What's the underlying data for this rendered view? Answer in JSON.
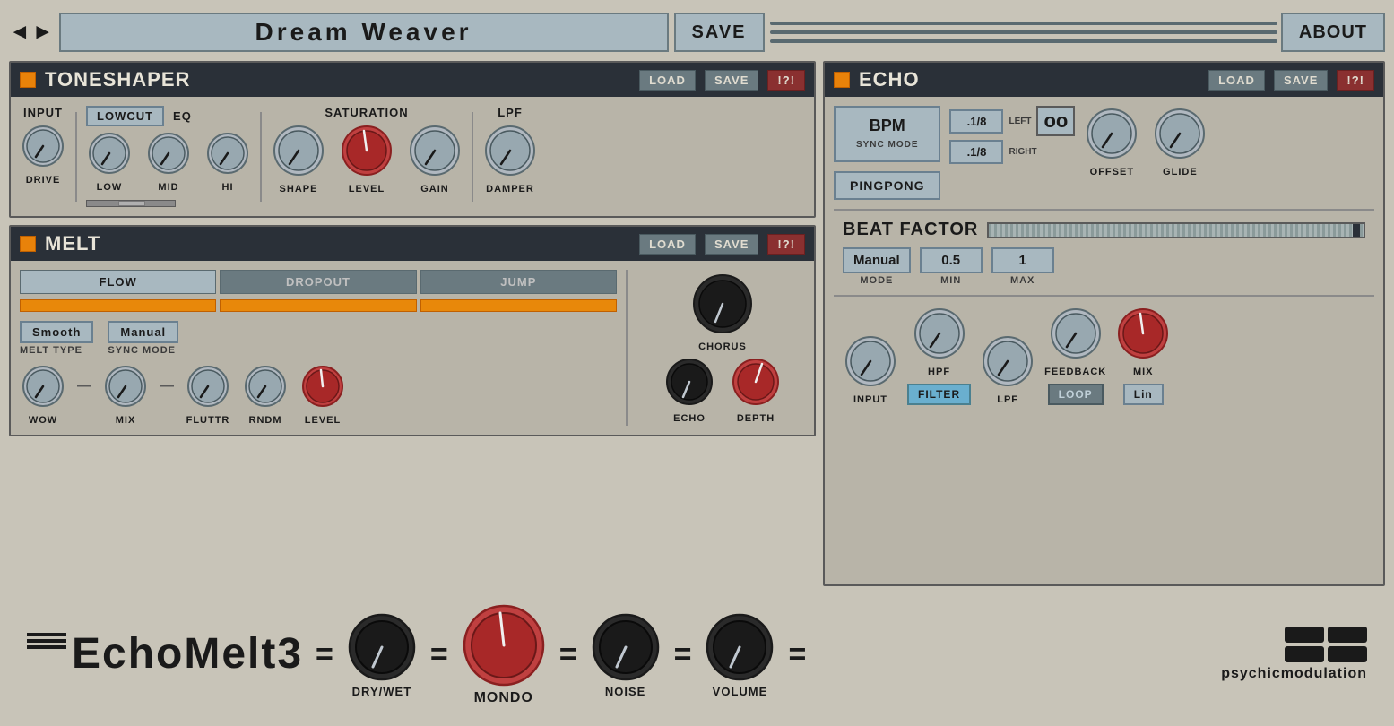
{
  "header": {
    "preset_name": "Dream  Weaver",
    "save_label": "SAVE",
    "about_label": "ABOUT",
    "arrow_left": "◄",
    "arrow_right": "►"
  },
  "toneshaper": {
    "title": "TONESHAPER",
    "load_label": "LOAD",
    "save_label": "SAVE",
    "danger_label": "!?!",
    "input_label": "INPUT",
    "drive_label": "DRIVE",
    "lowcut_label": "LOWCUT",
    "eq_label": "EQ",
    "low_label": "LOW",
    "mid_label": "MID",
    "hi_label": "HI",
    "saturation_label": "SATURATION",
    "shape_label": "SHAPE",
    "level_label": "LEVEL",
    "gain_label": "GAIN",
    "lpf_label": "LPF",
    "damper_label": "DAMPER"
  },
  "melt": {
    "title": "MELT",
    "load_label": "LOAD",
    "save_label": "SAVE",
    "danger_label": "!?!",
    "tab_flow": "FLOW",
    "tab_dropout": "DROPOUT",
    "tab_jump": "JUMP",
    "melt_type_label": "Smooth",
    "melt_type_sublabel": "MELT TYPE",
    "sync_mode_label": "Manual",
    "sync_mode_sublabel": "SYNC MODE",
    "wow_label": "WOW",
    "mix_label": "MIX",
    "fluttr_label": "FLUTTR",
    "rndm_label": "RNDM",
    "level_label": "LEVEL",
    "chorus_label": "CHORUS",
    "echo_label": "ECHO",
    "depth_label": "DEPTH"
  },
  "echo": {
    "title": "ECHO",
    "load_label": "LOAD",
    "save_label": "SAVE",
    "danger_label": "!?!",
    "sync_mode_label": "BPM",
    "sync_mode_sublabel": "SYNC MODE",
    "left_delay_label": ".1/8",
    "left_label": "LEFT",
    "infinity_label": "oo",
    "pingpong_label": "PINGPONG",
    "right_delay_label": ".1/8",
    "right_label": "RIGHT",
    "offset_label": "OFFSET",
    "glide_label": "GLIDE"
  },
  "beat_factor": {
    "title": "BEAT FACTOR",
    "mode_label": "Manual",
    "mode_sublabel": "MODE",
    "min_label": "0.5",
    "min_sublabel": "MIN",
    "max_label": "1",
    "max_sublabel": "MAX"
  },
  "echo_bottom": {
    "input_label": "INPUT",
    "hpf_label": "HPF",
    "lpf_label": "LPF",
    "feedback_label": "FEEDBACK",
    "mix_label": "MIX",
    "filter_badge": "FILTER",
    "loop_badge": "LOOP",
    "lin_badge": "Lin"
  },
  "bottom": {
    "logo": "EchoMelt3",
    "drywet_label": "DRY/WET",
    "mondo_label": "MONDO",
    "noise_label": "NOISE",
    "volume_label": "VOLUME",
    "pm_label": "psychicmodulation"
  }
}
